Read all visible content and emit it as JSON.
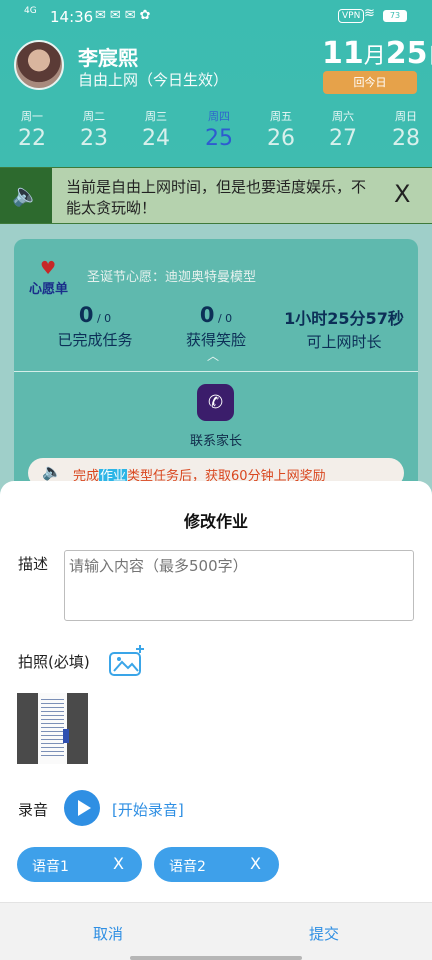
{
  "status_bar": {
    "network": "4G",
    "time": "14:36",
    "vpn": "VPN",
    "battery": "73"
  },
  "header": {
    "name": "李宸熙",
    "mode": "自由上网（今日生效）",
    "date_month": "11",
    "date_month_unit": "月",
    "date_day": "25",
    "date_day_unit": "日",
    "today_button": "回今日"
  },
  "week": [
    {
      "label": "周一",
      "date": "22"
    },
    {
      "label": "周二",
      "date": "23"
    },
    {
      "label": "周三",
      "date": "24"
    },
    {
      "label": "周四",
      "date": "25",
      "active": true
    },
    {
      "label": "周五",
      "date": "26"
    },
    {
      "label": "周六",
      "date": "27"
    },
    {
      "label": "周日",
      "date": "28"
    }
  ],
  "notice": {
    "text": "当前是自由上网时间，但是也要适度娱乐，不能太贪玩呦！",
    "close": "X"
  },
  "card": {
    "wish_label": "心愿单",
    "wish_text": "圣诞节心愿：迪迦奥特曼模型",
    "stats": [
      {
        "value": "0",
        "suffix": " / 0",
        "label": "已完成任务"
      },
      {
        "value": "0",
        "suffix": " / 0",
        "label": "获得笑脸"
      },
      {
        "value": "1小时25分57秒",
        "suffix": "",
        "label": "可上网时长"
      }
    ],
    "contact_label": "联系家长",
    "reward_prefix": "完成",
    "reward_highlight": "作业",
    "reward_suffix": "类型任务后，获取60分钟上网奖励"
  },
  "sheet": {
    "title": "修改作业",
    "desc_label": "描述",
    "desc_placeholder": "请输入内容（最多500字）",
    "photo_label": "拍照(必填)",
    "record_label": "录音",
    "record_link": "[开始录音]",
    "voices": [
      {
        "label": "语音1",
        "close": "X"
      },
      {
        "label": "语音2",
        "close": "X"
      }
    ],
    "cancel": "取消",
    "submit": "提交"
  }
}
